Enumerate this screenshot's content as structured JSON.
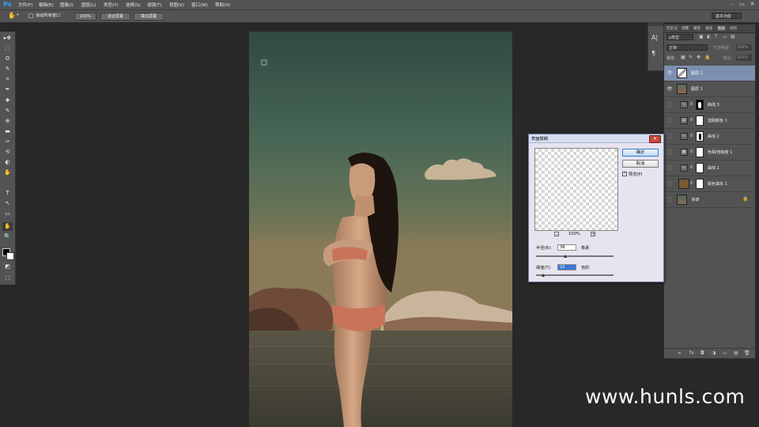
{
  "menubar": {
    "logo": "Ps",
    "items": [
      "文件(F)",
      "编辑(E)",
      "图像(I)",
      "图层(L)",
      "类型(Y)",
      "选择(S)",
      "滤镜(T)",
      "视图(V)",
      "窗口(W)",
      "帮助(H)"
    ],
    "window_controls": [
      "–",
      "▭",
      "✕"
    ]
  },
  "options": {
    "scroll_all_windows_label": "滚动所有窗口",
    "btn_100": "100%",
    "btn_fit_screen": "适合屏幕",
    "btn_fill_screen": "填充屏幕",
    "workspace": "基本功能"
  },
  "tools": [
    "▸✥",
    "⬚",
    "ʘ",
    "✎",
    "⌗",
    "✒",
    "✚",
    "✎",
    "⊕",
    "▬",
    "✑",
    "⟲",
    "◐",
    "✋",
    "T",
    "↖",
    "▭",
    "✋",
    "🔍",
    "◩",
    "⬚",
    "▭"
  ],
  "layers_panel": {
    "tabs": [
      "历史记",
      "调整",
      "属性",
      "通道",
      "路径",
      "图层",
      "动作"
    ],
    "filter_kind": "ρ类型",
    "blend_mode": "正常",
    "opacity_label": "不透明度:",
    "opacity_value": "100%",
    "lock_label": "锁定:",
    "fill_label": "填充:",
    "fill_value": "100%",
    "layers": [
      {
        "name": "图层 2",
        "visible": true,
        "selected": true,
        "kind": "pixel"
      },
      {
        "name": "图层 1",
        "visible": true,
        "selected": false,
        "kind": "pixel"
      },
      {
        "name": "曲线 3",
        "visible": false,
        "selected": false,
        "kind": "adjust",
        "icon": "curves"
      },
      {
        "name": "选取颜色 1",
        "visible": false,
        "selected": false,
        "kind": "adjust",
        "icon": "selective"
      },
      {
        "name": "曲线 2",
        "visible": false,
        "selected": false,
        "kind": "adjust",
        "icon": "curves"
      },
      {
        "name": "色相/饱和度 1",
        "visible": false,
        "selected": false,
        "kind": "adjust",
        "icon": "hue"
      },
      {
        "name": "曲线 1",
        "visible": false,
        "selected": false,
        "kind": "adjust",
        "icon": "curves"
      },
      {
        "name": "颜色填充 1",
        "visible": false,
        "selected": false,
        "kind": "fill"
      },
      {
        "name": "背景",
        "visible": false,
        "selected": false,
        "kind": "background"
      }
    ],
    "footer_icons": [
      "∞",
      "fx",
      "◘",
      "◑",
      "▭",
      "▤",
      "🗑"
    ]
  },
  "dialog": {
    "title": "表面模糊",
    "ok_label": "确定",
    "cancel_label": "取消",
    "preview_label": "预览(P)",
    "preview_checked": true,
    "zoom_value": "100%",
    "radius_label": "半径(R):",
    "radius_value": "38",
    "radius_unit": "像素",
    "radius_fraction": 0.38,
    "threshold_label": "阈值(T):",
    "threshold_value": "22",
    "threshold_unit": "色阶",
    "threshold_fraction": 0.09
  },
  "watermark": "www.hunls.com",
  "colors": {
    "selected_layer": "#7c8fb0",
    "panel_bg": "#535353",
    "app_bg": "#282828"
  }
}
